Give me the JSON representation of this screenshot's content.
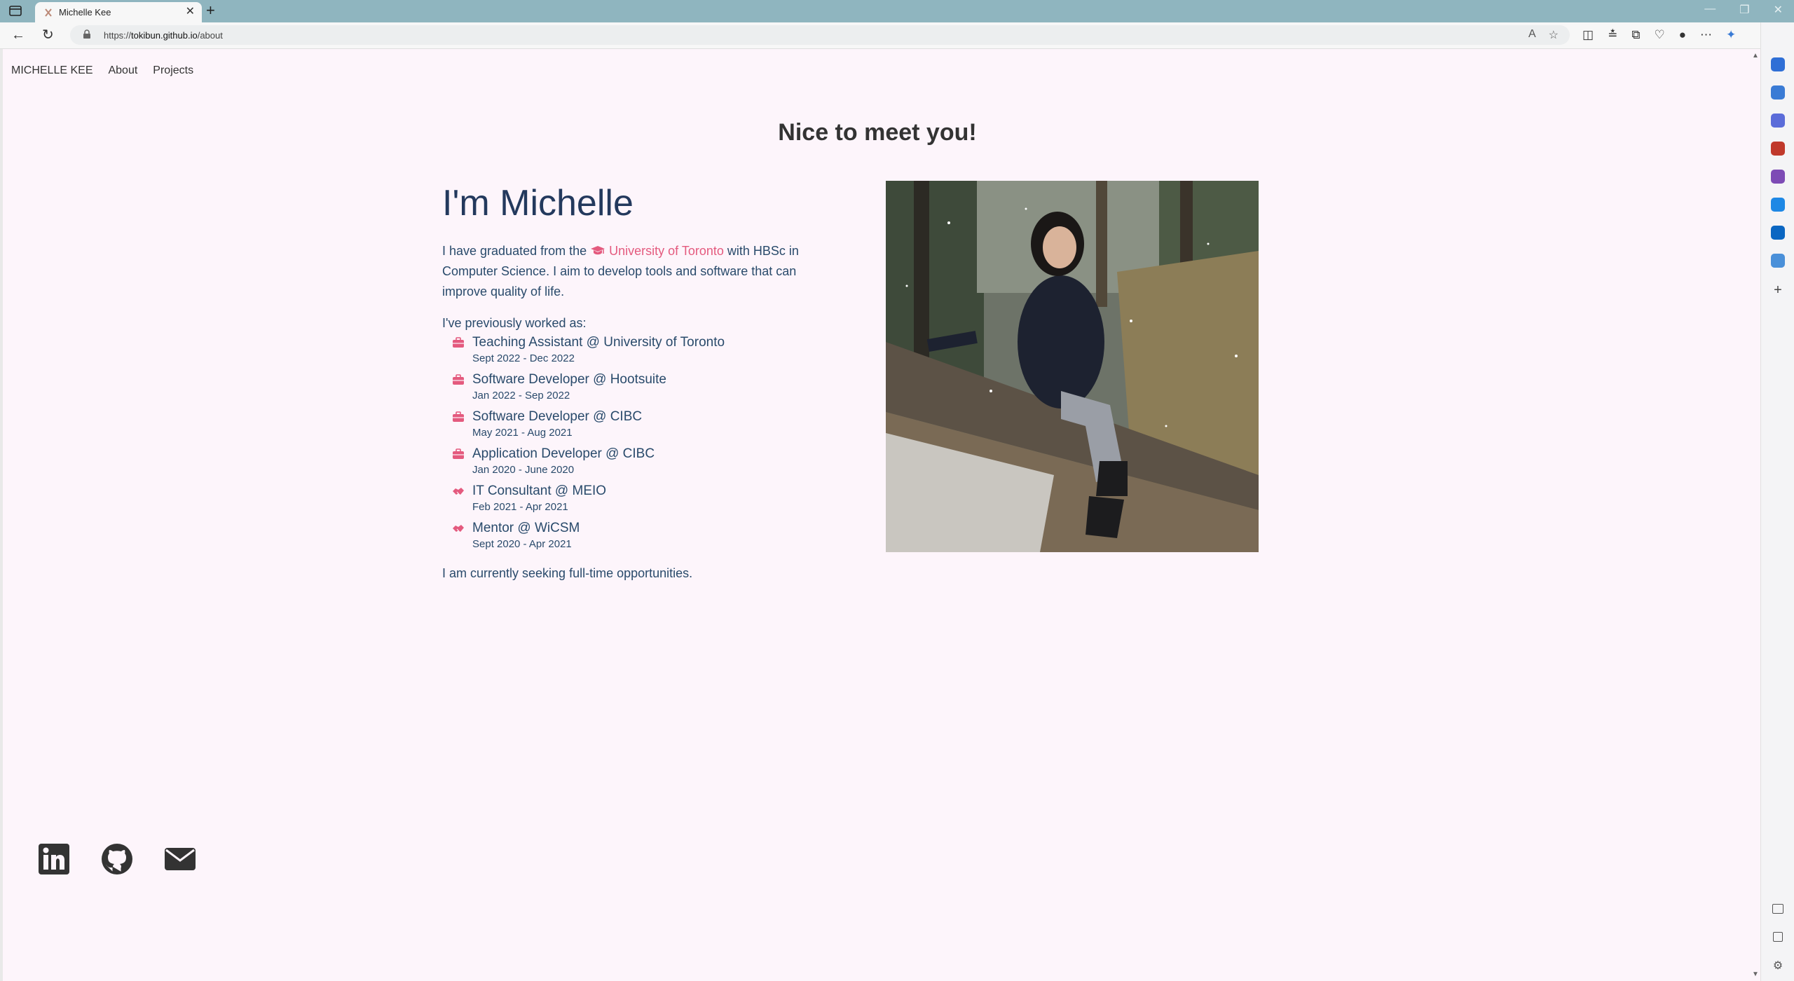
{
  "browser": {
    "tab_title": "Michelle Kee",
    "url_prefix": "https://",
    "url_domain": "tokibun.github.io",
    "url_path": "/about"
  },
  "nav": {
    "brand": "MICHELLE KEE",
    "about": "About",
    "projects": "Projects"
  },
  "page": {
    "heading": "Nice to meet you!",
    "greeting": "I'm Michelle",
    "intro_before": "I have graduated from the ",
    "intro_link": "University of Toronto",
    "intro_after": " with HBSc in Computer Science. I aim to develop tools and software that can improve quality of life.",
    "worked_label": "I've previously worked as:",
    "jobs": [
      {
        "title": "Teaching Assistant @ University of Toronto",
        "dates": "Sept 2022 - Dec 2022",
        "icon": "briefcase-icon"
      },
      {
        "title": "Software Developer @ Hootsuite",
        "dates": "Jan 2022 - Sep 2022",
        "icon": "briefcase-icon"
      },
      {
        "title": "Software Developer @ CIBC",
        "dates": "May 2021 - Aug 2021",
        "icon": "briefcase-icon"
      },
      {
        "title": "Application Developer @ CIBC",
        "dates": "Jan 2020 - June 2020",
        "icon": "briefcase-icon"
      },
      {
        "title": "IT Consultant @ MEIO",
        "dates": "Feb 2021 - Apr 2021",
        "icon": "handshake-icon"
      },
      {
        "title": "Mentor @ WiCSM",
        "dates": "Sept 2020 - Apr 2021",
        "icon": "handshake-icon"
      }
    ],
    "seeking": "I am currently seeking full-time opportunities."
  },
  "colors": {
    "background": "#fdf5fb",
    "accent": "#e45a7e",
    "text": "#294a6b"
  },
  "socials": [
    "linkedin-icon",
    "github-icon",
    "email-icon"
  ]
}
